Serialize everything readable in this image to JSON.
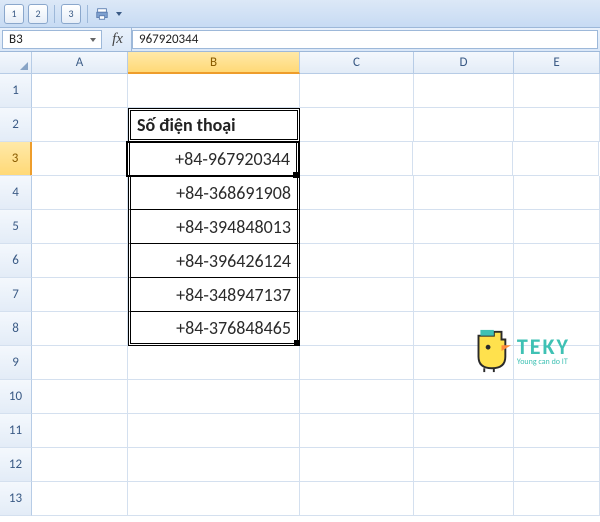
{
  "qat": {
    "win1": "1",
    "win2": "2",
    "win3": "3"
  },
  "namebox": "B3",
  "fx_label": "fx",
  "formula_value": "967920344",
  "columns": [
    "A",
    "B",
    "C",
    "D",
    "E"
  ],
  "rows": [
    "1",
    "2",
    "3",
    "4",
    "5",
    "6",
    "7",
    "8",
    "9",
    "10",
    "11",
    "12",
    "13"
  ],
  "active_cell": "B3",
  "table": {
    "header": "Số điện thoại",
    "data": [
      "+84-967920344",
      "+84-368691908",
      "+84-394848013",
      "+84-396426124",
      "+84-348947137",
      "+84-376848465"
    ]
  },
  "logo": {
    "brand": "TEKY",
    "tagline": "Young can do IT"
  }
}
